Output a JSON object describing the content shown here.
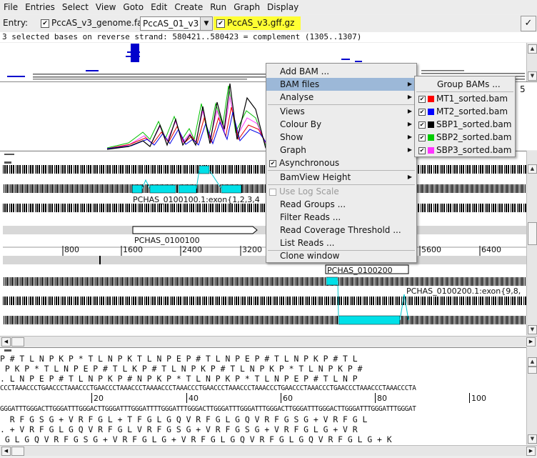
{
  "menubar": {
    "items": [
      "File",
      "Entries",
      "Select",
      "View",
      "Goto",
      "Edit",
      "Create",
      "Run",
      "Graph",
      "Display"
    ]
  },
  "entrybar": {
    "label": "Entry:",
    "genome_file": "PccAS_v3_genome.fa",
    "sequence_select": "PccAS_01_v3",
    "gff_file": "PccAS_v3.gff.gz",
    "confirm_icon": "check-icon"
  },
  "status": {
    "text": "3 selected bases on reverse strand: 580421..580423  = complement (1305..1307)"
  },
  "feature_view": {
    "feature1_label": "PCHAS_0100100.1:exon{1,2,3,4",
    "gene1_label": "PCHAS_0100100",
    "gene2_label": "PCHAS_0100200",
    "feature2_label": "PCHAS_0100200.1:exon{9,8,",
    "ruler_ticks": [
      "800",
      "1600",
      "2400",
      "3200",
      "5600",
      "6400"
    ],
    "graph_partial_label": "5"
  },
  "colors": {
    "cyan_feature": "#00e0e8",
    "selection": "#9cb8d8",
    "coverage_red": "#e00000",
    "coverage_blue": "#0000e8",
    "coverage_green": "#00c000",
    "coverage_magenta": "#ff30ff",
    "entry_highlight": "#ffff33"
  },
  "context_menu": {
    "items": [
      {
        "label": "Add BAM ...",
        "submenu": false,
        "enabled": true
      },
      {
        "label": "BAM files",
        "submenu": true,
        "enabled": true,
        "selected": true
      },
      {
        "label": "Analyse",
        "submenu": true,
        "enabled": true
      },
      {
        "label": "Views",
        "submenu": true,
        "enabled": true
      },
      {
        "label": "Colour By",
        "submenu": true,
        "enabled": true
      },
      {
        "label": "Show",
        "submenu": true,
        "enabled": true
      },
      {
        "label": "Graph",
        "submenu": true,
        "enabled": true
      },
      {
        "label": "Asynchronous",
        "checkbox": true,
        "checked": true,
        "enabled": true
      },
      {
        "label": "BamView Height",
        "submenu": true,
        "enabled": true
      },
      {
        "label": "Use Log Scale",
        "checkbox": true,
        "checked": false,
        "enabled": false
      },
      {
        "label": "Read Groups ...",
        "enabled": true
      },
      {
        "label": "Filter Reads ...",
        "enabled": true
      },
      {
        "label": "Read Coverage Threshold ...",
        "enabled": true
      },
      {
        "label": "List Reads ...",
        "enabled": true
      },
      {
        "label": "Clone window",
        "enabled": true
      }
    ]
  },
  "bam_submenu": {
    "header": "Group BAMs ...",
    "files": [
      {
        "name": "MT1_sorted.bam",
        "color": "#ff0000",
        "checked": true
      },
      {
        "name": "MT2_sorted.bam",
        "color": "#0000ff",
        "checked": true
      },
      {
        "name": "SBP1_sorted.bam",
        "color": "#000000",
        "checked": true
      },
      {
        "name": "SBP2_sorted.bam",
        "color": "#00cc00",
        "checked": true
      },
      {
        "name": "SBP3_sorted.bam",
        "color": "#ff33ff",
        "checked": true
      }
    ]
  },
  "sequence_view": {
    "frames_forward": [
      "P # T L N P K P * T L N P K T L N P E P # T L N P E P # T L N P K P # T L",
      " P K P * T L N P E P # T L K P # T L N P K P # T L N P K P * T L N P K P #",
      ". L N P E P # T L N P K P # N P K P * T L N P K P * T L N P E P # T L N P"
    ],
    "dna_forward": "CCCTAAACCCTGAACCCTAAACCCTGAACCCTAAACCCTAAAACCCTAAACCCTGAACCCTAAACCCTAAACCCTGAACCCTAAACCCTGAACCCTAAACCCTAAACCCTA",
    "ruler_ticks": [
      "20",
      "40",
      "60",
      "80",
      "100"
    ],
    "dna_reverse": "GGGATTTGGGACTTGGGATTTGGGACTTGGGATTTGGGATTTTGGGATTTGGGACTTGGGATTTGGGATTTGGGACTTGGGATTTGGGACTTGGGATTTGGGATTTGGGAT",
    "frames_reverse": [
      "  R F G S G + V R F G L + T F G L G Q V R F G L G Q V R F G S G + V R F G L",
      ". + V R F G L G Q V R F G L V R F G S G + V R F G S G + V R F G L G + V R",
      " G L G Q V R F G S G + V R F G L G + V R F G L G Q V R F G L G Q V R F G L G + K"
    ]
  }
}
